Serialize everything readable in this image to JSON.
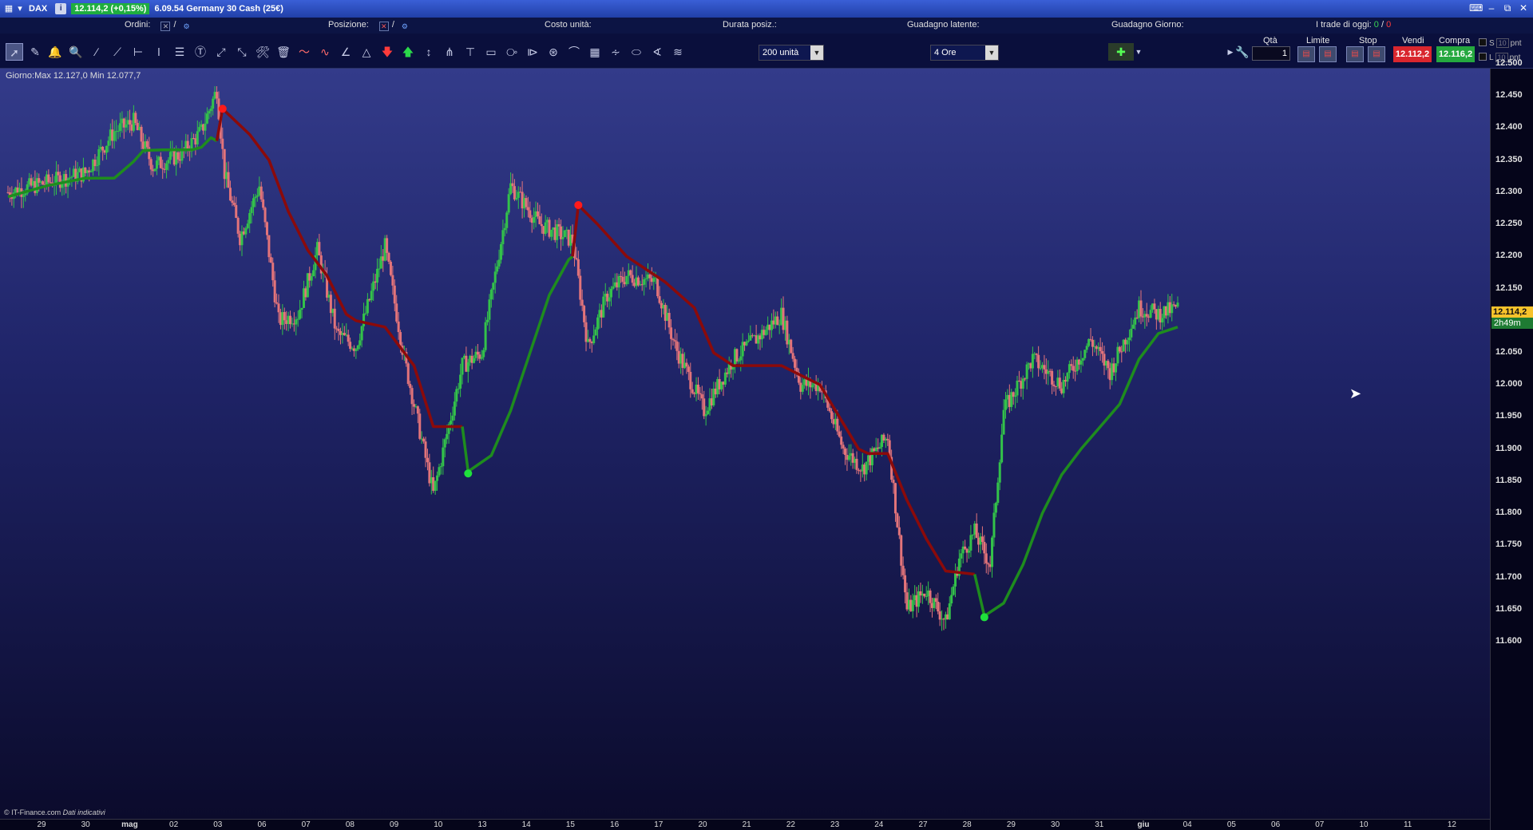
{
  "titlebar": {
    "symbol": "DAX",
    "info_badge": "i",
    "price_change": "12.114,2 (+0,15%)",
    "instrument": "6.09.54 Germany 30 Cash (25€)"
  },
  "infobar": {
    "orders_label": "Ordini:",
    "orders_sep": "/",
    "position_label": "Posizione:",
    "position_sep": "/",
    "unit_cost_label": "Costo unità:",
    "duration_label": "Durata posiz.:",
    "latent_gain_label": "Guadagno latente:",
    "day_gain_label": "Guadagno Giorno:",
    "trades_today_label": "I trade di oggi:",
    "trades_green": "0",
    "trades_sep": "/",
    "trades_red": "0"
  },
  "toolbar": {
    "units_select": "200 unità",
    "timeframe_select": "4 Ore",
    "qty_label": "Qtà",
    "qty_value": "1",
    "limit_label": "Limite",
    "stop_label": "Stop",
    "sell_label": "Vendi",
    "buy_label": "Compra",
    "sell_price": "12.112,2",
    "buy_price": "12.116,2",
    "s_label": "S",
    "l_label": "L",
    "s_value": "10",
    "l_value": "10",
    "pnt_label_s": "pnt",
    "pnt_label_l": "pnt"
  },
  "chart_header": {
    "range_text": "Giorno:Max 12.127,0 Min 12.077,7"
  },
  "footer": {
    "source": "© IT-Finance.com",
    "disclaimer": "Dati indicativi"
  },
  "price_axis": {
    "last_price": "12.114,2",
    "countdown": "2h49m"
  },
  "colors": {
    "bull": "#33c24a",
    "bear": "#e3747a",
    "trend_up": "#1e8c1e",
    "trend_down": "#8b0a0a",
    "pivot_high": "#ff1a1a",
    "pivot_low": "#1fe03c"
  },
  "chart_data": {
    "type": "candlestick",
    "ylim": [
      11580,
      12510
    ],
    "yticks": [
      "11.600",
      "11.650",
      "11.700",
      "11.750",
      "11.800",
      "11.850",
      "11.900",
      "11.950",
      "12.000",
      "12.050",
      "12.100",
      "12.150",
      "12.200",
      "12.250",
      "12.300",
      "12.350",
      "12.400",
      "12.450",
      "12.500"
    ],
    "x_labels": [
      "29",
      "30",
      "mag",
      "02",
      "03",
      "06",
      "07",
      "08",
      "09",
      "10",
      "13",
      "14",
      "15",
      "16",
      "17",
      "20",
      "21",
      "22",
      "23",
      "24",
      "27",
      "28",
      "29",
      "30",
      "31",
      "giu",
      "04",
      "05",
      "06",
      "07",
      "10",
      "11",
      "12"
    ],
    "trend_line": {
      "segments": [
        {
          "trend": "up",
          "points": [
            [
              0,
              12293
            ],
            [
              20,
              12310
            ],
            [
              40,
              12322
            ],
            [
              55,
              12322
            ],
            [
              65,
              12348
            ],
            [
              70,
              12365
            ],
            [
              80,
              12366
            ],
            [
              95,
              12366
            ],
            [
              100,
              12370
            ],
            [
              105,
              12385
            ],
            [
              108,
              12380
            ]
          ]
        },
        {
          "trend": "down",
          "points": [
            [
              108,
              12380
            ],
            [
              111,
              12430
            ],
            [
              125,
              12390
            ],
            [
              135,
              12350
            ],
            [
              145,
              12270
            ],
            [
              155,
              12210
            ],
            [
              165,
              12170
            ],
            [
              175,
              12110
            ],
            [
              180,
              12100
            ],
            [
              195,
              12090
            ],
            [
              210,
              12030
            ],
            [
              220,
              11935
            ],
            [
              235,
              11935
            ]
          ]
        },
        {
          "trend": "up",
          "points": [
            [
              235,
              11935
            ],
            [
              238,
              11865
            ],
            [
              250,
              11890
            ],
            [
              260,
              11960
            ],
            [
              270,
              12050
            ],
            [
              280,
              12140
            ],
            [
              290,
              12195
            ],
            [
              292,
              12200
            ]
          ]
        },
        {
          "trend": "down",
          "points": [
            [
              292,
              12200
            ],
            [
              295,
              12280
            ],
            [
              305,
              12250
            ],
            [
              320,
              12200
            ],
            [
              340,
              12160
            ],
            [
              355,
              12120
            ],
            [
              365,
              12050
            ],
            [
              375,
              12030
            ],
            [
              400,
              12030
            ],
            [
              420,
              12000
            ],
            [
              430,
              11950
            ],
            [
              440,
              11900
            ],
            [
              445,
              11893
            ],
            [
              455,
              11893
            ],
            [
              465,
              11820
            ],
            [
              475,
              11760
            ],
            [
              485,
              11710
            ],
            [
              500,
              11705
            ]
          ]
        },
        {
          "trend": "up",
          "points": [
            [
              500,
              11705
            ],
            [
              505,
              11640
            ],
            [
              515,
              11660
            ],
            [
              525,
              11720
            ],
            [
              535,
              11800
            ],
            [
              545,
              11860
            ],
            [
              555,
              11900
            ],
            [
              565,
              11935
            ],
            [
              575,
              11970
            ],
            [
              585,
              12040
            ],
            [
              595,
              12080
            ],
            [
              605,
              12090
            ]
          ]
        }
      ],
      "pivots": [
        {
          "type": "high",
          "index": 111,
          "value": 12430
        },
        {
          "type": "low",
          "index": 238,
          "value": 11862
        },
        {
          "type": "high",
          "index": 295,
          "value": 12280
        },
        {
          "type": "low",
          "index": 505,
          "value": 11638
        }
      ]
    },
    "candles_per_label": 19,
    "total_candles": 606,
    "waypoints": [
      [
        0,
        12300
      ],
      [
        20,
        12315
      ],
      [
        40,
        12330
      ],
      [
        55,
        12395
      ],
      [
        65,
        12410
      ],
      [
        75,
        12340
      ],
      [
        90,
        12360
      ],
      [
        100,
        12395
      ],
      [
        108,
        12460
      ],
      [
        112,
        12330
      ],
      [
        120,
        12230
      ],
      [
        130,
        12310
      ],
      [
        140,
        12100
      ],
      [
        150,
        12110
      ],
      [
        160,
        12210
      ],
      [
        170,
        12080
      ],
      [
        180,
        12060
      ],
      [
        195,
        12215
      ],
      [
        205,
        12040
      ],
      [
        220,
        11830
      ],
      [
        235,
        12030
      ],
      [
        245,
        12050
      ],
      [
        260,
        12310
      ],
      [
        275,
        12250
      ],
      [
        292,
        12225
      ],
      [
        300,
        12060
      ],
      [
        310,
        12140
      ],
      [
        320,
        12170
      ],
      [
        335,
        12160
      ],
      [
        345,
        12060
      ],
      [
        360,
        11960
      ],
      [
        375,
        12040
      ],
      [
        390,
        12080
      ],
      [
        400,
        12110
      ],
      [
        410,
        12000
      ],
      [
        420,
        12000
      ],
      [
        432,
        11900
      ],
      [
        442,
        11870
      ],
      [
        455,
        11920
      ],
      [
        465,
        11650
      ],
      [
        475,
        11680
      ],
      [
        485,
        11630
      ],
      [
        492,
        11730
      ],
      [
        500,
        11770
      ],
      [
        508,
        11720
      ],
      [
        515,
        11960
      ],
      [
        530,
        12040
      ],
      [
        545,
        12000
      ],
      [
        560,
        12070
      ],
      [
        570,
        12020
      ],
      [
        585,
        12120
      ],
      [
        595,
        12110
      ],
      [
        605,
        12120
      ]
    ]
  }
}
